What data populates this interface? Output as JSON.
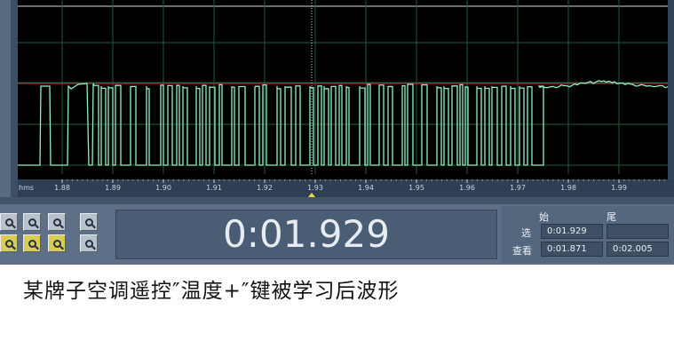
{
  "waveform": {
    "time_unit": "hms",
    "ticks": [
      "1.88",
      "1.89",
      "1.90",
      "1.91",
      "1.92",
      "1.93",
      "1.94",
      "1.95",
      "1.96",
      "1.97",
      "1.98",
      "1.99"
    ]
  },
  "zoom_buttons": [
    {
      "name": "zoom-in-icon"
    },
    {
      "name": "zoom-out-icon"
    },
    {
      "name": "zoom-full-icon"
    },
    {
      "name": "zoom-in-vertical-icon"
    },
    {
      "name": "zoom-selection-icon"
    },
    {
      "name": "zoom-left-icon"
    },
    {
      "name": "zoom-right-icon"
    },
    {
      "name": "zoom-out-vertical-icon"
    }
  ],
  "time_display": "0:01.929",
  "selection_panel": {
    "col_start": "始",
    "col_end": "尾",
    "row_select_label": "选",
    "row_view_label": "查看",
    "select_start": "0:01.929",
    "select_end": "",
    "view_start": "0:01.871",
    "view_end": "0:02.005"
  },
  "caption": "某牌子空调遥控″温度+″键被学习后波形",
  "colors": {
    "waveform": "#8ff0c0",
    "background": "#000000",
    "reference_line": "#b03a3a",
    "grid": "#1f5b3a"
  }
}
